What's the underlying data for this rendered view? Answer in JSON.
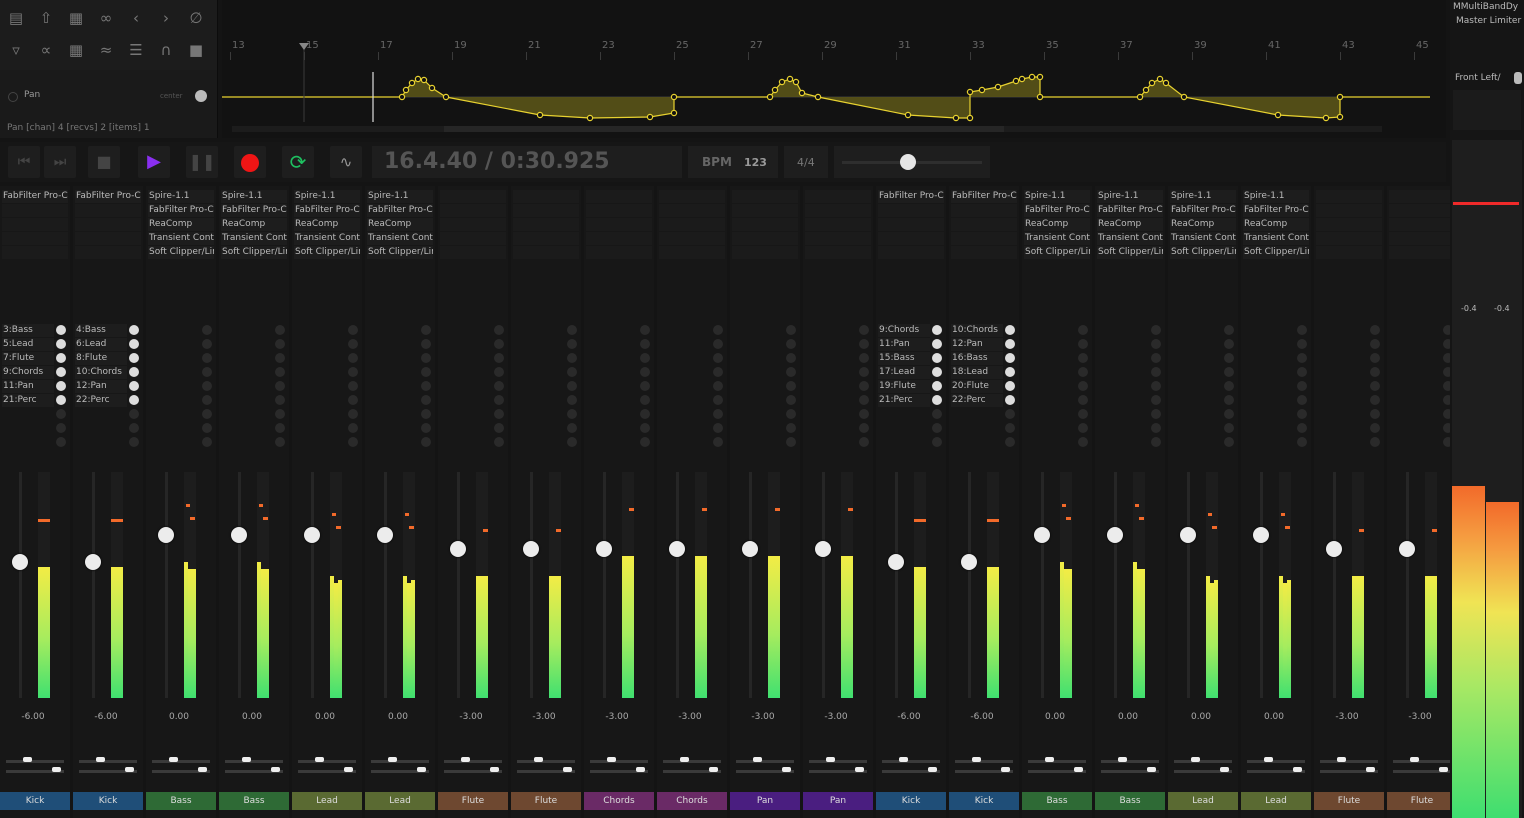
{
  "env": {
    "label": "Pan",
    "center": "center",
    "info": "Pan [chan] 4 [recvs] 2 [items] 1"
  },
  "ruler": [
    "13",
    "15",
    "17",
    "19",
    "21",
    "23",
    "25",
    "27",
    "29",
    "31",
    "33",
    "35",
    "37",
    "39",
    "41",
    "43",
    "45"
  ],
  "transport": {
    "time": "16.4.40 / 0:30.925",
    "bpm_label": "BPM",
    "bpm": "123",
    "timesig": "4/4",
    "volume": 0.47
  },
  "icons": {
    "toolbar": [
      "document-icon",
      "import-icon",
      "save-icon",
      "paperclip-icon",
      "undo-icon",
      "redo-icon",
      "trim-icon",
      "envelope-icon",
      "link-icon",
      "grid-icon",
      "ripple-icon",
      "columns-icon",
      "loop-icon",
      "lock-icon"
    ]
  },
  "channels": [
    {
      "name": "Kick",
      "color": "#1f4e78",
      "fx": [
        "FabFilter Pro-C"
      ],
      "sends": [
        "3:Bass",
        "5:Lead",
        "7:Flute",
        "9:Chords",
        "11:Pan",
        "21:Perc"
      ],
      "volume": "-6.00",
      "fader": 0.6,
      "meterL": 0.58,
      "meterR": 0.58,
      "peakL": 0.79,
      "peakR": 0.79,
      "pan": 0.5
    },
    {
      "name": "Kick",
      "color": "#1f4e78",
      "fx": [
        "FabFilter Pro-C"
      ],
      "sends": [
        "4:Bass",
        "6:Lead",
        "8:Flute",
        "10:Chords",
        "12:Pan",
        "22:Perc"
      ],
      "volume": "-6.00",
      "fader": 0.6,
      "meterL": 0.58,
      "meterR": 0.58,
      "peakL": 0.79,
      "peakR": 0.79,
      "pan": 0.5
    },
    {
      "name": "Bass",
      "color": "#2e6a35",
      "fx": [
        "Spire-1.1",
        "FabFilter Pro-C",
        "ReaComp",
        "Transient Cont",
        "Soft Clipper/Lir"
      ],
      "sends": [],
      "volume": "0.00",
      "fader": 0.72,
      "meterL": 0.6,
      "meterR": 0.57,
      "peakL": 0.86,
      "peakR": 0.8,
      "pan": 0.5
    },
    {
      "name": "Bass",
      "color": "#2e6a35",
      "fx": [
        "Spire-1.1",
        "FabFilter Pro-C",
        "ReaComp",
        "Transient Cont",
        "Soft Clipper/Lir"
      ],
      "sends": [],
      "volume": "0.00",
      "fader": 0.72,
      "meterL": 0.6,
      "meterR": 0.57,
      "peakL": 0.86,
      "peakR": 0.8,
      "pan": 0.5
    },
    {
      "name": "Lead",
      "color": "#5a6a32",
      "fx": [
        "Spire-1.1",
        "FabFilter Pro-C",
        "ReaComp",
        "Transient Cont",
        "Soft Clipper/Lir"
      ],
      "sends": [],
      "volume": "0.00",
      "fader": 0.72,
      "meterL": 0.54,
      "meterR": 0.52,
      "peakL": 0.82,
      "peakR": 0.76,
      "pan": 0.5
    },
    {
      "name": "Lead",
      "color": "#5a6a32",
      "fx": [
        "Spire-1.1",
        "FabFilter Pro-C",
        "ReaComp",
        "Transient Cont",
        "Soft Clipper/Lir"
      ],
      "sends": [],
      "volume": "0.00",
      "fader": 0.72,
      "meterL": 0.54,
      "meterR": 0.52,
      "peakL": 0.82,
      "peakR": 0.76,
      "pan": 0.5
    },
    {
      "name": "Flute",
      "color": "#6e4830",
      "fx": [],
      "sends": [],
      "volume": "-3.00",
      "fader": 0.66,
      "meterL": 0.54,
      "meterR": 0.54,
      "peakL": 0.75,
      "peakR": 0.75,
      "pan": 0.5
    },
    {
      "name": "Flute",
      "color": "#6e4830",
      "fx": [],
      "sends": [],
      "volume": "-3.00",
      "fader": 0.66,
      "meterL": 0.54,
      "meterR": 0.54,
      "peakL": 0.75,
      "peakR": 0.75,
      "pan": 0.5
    },
    {
      "name": "Chords",
      "color": "#6a2a66",
      "fx": [],
      "sends": [],
      "volume": "-3.00",
      "fader": 0.66,
      "meterL": 0.63,
      "meterR": 0.63,
      "peakL": 0.84,
      "peakR": 0.84,
      "pan": 0.5
    },
    {
      "name": "Chords",
      "color": "#6a2a66",
      "fx": [],
      "sends": [],
      "volume": "-3.00",
      "fader": 0.66,
      "meterL": 0.63,
      "meterR": 0.63,
      "peakL": 0.84,
      "peakR": 0.84,
      "pan": 0.5
    },
    {
      "name": "Pan",
      "color": "#4a1e80",
      "fx": [],
      "sends": [],
      "volume": "-3.00",
      "fader": 0.66,
      "meterL": 0.63,
      "meterR": 0.63,
      "peakL": 0.84,
      "peakR": 0.84,
      "pan": 0.5
    },
    {
      "name": "Pan",
      "color": "#4a1e80",
      "fx": [],
      "sends": [],
      "volume": "-3.00",
      "fader": 0.66,
      "meterL": 0.63,
      "meterR": 0.63,
      "peakL": 0.84,
      "peakR": 0.84,
      "pan": 0.5
    },
    {
      "name": "Kick",
      "color": "#1f4e78",
      "fx": [
        "FabFilter Pro-C"
      ],
      "sends": [
        "9:Chords",
        "11:Pan",
        "15:Bass",
        "17:Lead",
        "19:Flute",
        "21:Perc"
      ],
      "volume": "-6.00",
      "fader": 0.6,
      "meterL": 0.58,
      "meterR": 0.58,
      "peakL": 0.79,
      "peakR": 0.79,
      "pan": 0.5
    },
    {
      "name": "Kick",
      "color": "#1f4e78",
      "fx": [
        "FabFilter Pro-C"
      ],
      "sends": [
        "10:Chords",
        "12:Pan",
        "16:Bass",
        "18:Lead",
        "20:Flute",
        "22:Perc"
      ],
      "volume": "-6.00",
      "fader": 0.6,
      "meterL": 0.58,
      "meterR": 0.58,
      "peakL": 0.79,
      "peakR": 0.79,
      "pan": 0.5
    },
    {
      "name": "Bass",
      "color": "#2e6a35",
      "fx": [
        "Spire-1.1",
        "FabFilter Pro-C",
        "ReaComp",
        "Transient Cont",
        "Soft Clipper/Lir"
      ],
      "sends": [],
      "volume": "0.00",
      "fader": 0.72,
      "meterL": 0.6,
      "meterR": 0.57,
      "peakL": 0.86,
      "peakR": 0.8,
      "pan": 0.5
    },
    {
      "name": "Bass",
      "color": "#2e6a35",
      "fx": [
        "Spire-1.1",
        "FabFilter Pro-C",
        "ReaComp",
        "Transient Cont",
        "Soft Clipper/Lir"
      ],
      "sends": [],
      "volume": "0.00",
      "fader": 0.72,
      "meterL": 0.6,
      "meterR": 0.57,
      "peakL": 0.86,
      "peakR": 0.8,
      "pan": 0.5
    },
    {
      "name": "Lead",
      "color": "#5a6a32",
      "fx": [
        "Spire-1.1",
        "FabFilter Pro-C",
        "ReaComp",
        "Transient Cont",
        "Soft Clipper/Lir"
      ],
      "sends": [],
      "volume": "0.00",
      "fader": 0.72,
      "meterL": 0.54,
      "meterR": 0.52,
      "peakL": 0.82,
      "peakR": 0.76,
      "pan": 0.5
    },
    {
      "name": "Lead",
      "color": "#5a6a32",
      "fx": [
        "Spire-1.1",
        "FabFilter Pro-C",
        "ReaComp",
        "Transient Cont",
        "Soft Clipper/Lir"
      ],
      "sends": [],
      "volume": "0.00",
      "fader": 0.72,
      "meterL": 0.54,
      "meterR": 0.52,
      "peakL": 0.82,
      "peakR": 0.76,
      "pan": 0.5
    },
    {
      "name": "Flute",
      "color": "#6e4830",
      "fx": [],
      "sends": [],
      "volume": "-3.00",
      "fader": 0.66,
      "meterL": 0.54,
      "meterR": 0.54,
      "peakL": 0.75,
      "peakR": 0.75,
      "pan": 0.5
    },
    {
      "name": "Flute",
      "color": "#6e4830",
      "fx": [],
      "sends": [],
      "volume": "-3.00",
      "fader": 0.66,
      "meterL": 0.54,
      "meterR": 0.54,
      "peakL": 0.75,
      "peakR": 0.75,
      "pan": 0.5
    }
  ],
  "master": {
    "fx": [
      "MMultiBandDy",
      "Master Limiter"
    ],
    "output": "Front Left/",
    "peakL": "-0.4",
    "peakR": "-0.4",
    "meterL": 0.83,
    "meterR": 0.79
  }
}
